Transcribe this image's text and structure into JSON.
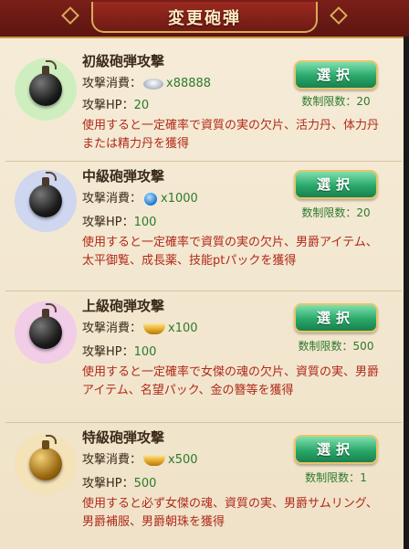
{
  "header": {
    "title": "変更砲弾"
  },
  "items": [
    {
      "name": "初級砲弾攻撃",
      "cost_label": "攻撃消費：",
      "cost_icon": "silver-ingot-icon",
      "cost_amount": "x88888",
      "hp_label": "攻撃HP：",
      "hp_value": "20",
      "description": "使用すると一定確率で資質の実の欠片、活力丹、体力丹または精力丹を獲得",
      "select_label": "選択",
      "limit_label": "数制限数：",
      "limit_value": "20",
      "circle_color": "#cfeec0"
    },
    {
      "name": "中級砲弾攻撃",
      "cost_label": "攻撃消費：",
      "cost_icon": "blue-gem-icon",
      "cost_amount": "x1000",
      "hp_label": "攻撃HP：",
      "hp_value": "100",
      "description": "使用すると一定確率で資質の実の欠片、男爵アイテム、太平御覧、成長薬、技能ptパックを獲得",
      "select_label": "選択",
      "limit_label": "数制限数：",
      "limit_value": "20",
      "circle_color": "#cfd6f0"
    },
    {
      "name": "上級砲弾攻撃",
      "cost_label": "攻撃消費：",
      "cost_icon": "gold-ingot-icon",
      "cost_amount": "x100",
      "hp_label": "攻撃HP：",
      "hp_value": "100",
      "description": "使用すると一定確率で女傑の魂の欠片、資質の実、男爵アイテム、名望パック、金の簪等を獲得",
      "select_label": "選択",
      "limit_label": "数制限数：",
      "limit_value": "500",
      "circle_color": "#f1cde8"
    },
    {
      "name": "特級砲弾攻撃",
      "cost_label": "攻撃消費：",
      "cost_icon": "gold-ingot-icon",
      "cost_amount": "x500",
      "hp_label": "攻撃HP：",
      "hp_value": "500",
      "description": "使用すると必ず女傑の魂、資質の実、男爵サムリング、男爵補服、男爵朝珠を獲得",
      "select_label": "選択",
      "limit_label": "数制限数：",
      "limit_value": "1",
      "circle_color": "#f4e2b8"
    }
  ],
  "colors": {
    "header_bg": "#6e1a13",
    "accent_green": "#2aa86a",
    "desc_red": "#b02a1a",
    "value_green": "#2d7a2d"
  }
}
